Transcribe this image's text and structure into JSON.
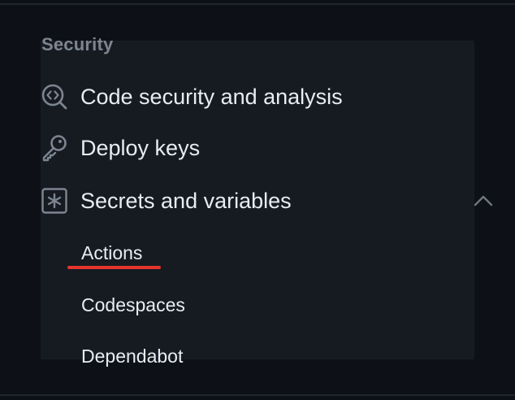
{
  "section": {
    "title": "Security"
  },
  "nav": {
    "items": [
      {
        "label": "Code security and analysis",
        "icon": "codescan-icon"
      },
      {
        "label": "Deploy keys",
        "icon": "key-icon"
      },
      {
        "label": "Secrets and variables",
        "icon": "key-asterisk-icon",
        "expanded": true
      }
    ],
    "subitems": [
      {
        "label": "Actions",
        "active": true
      },
      {
        "label": "Codespaces",
        "active": false
      },
      {
        "label": "Dependabot",
        "active": false
      }
    ]
  },
  "colors": {
    "background": "#0d1117",
    "panel": "#161b22",
    "text": "#e6edf3",
    "muted": "#7d8590",
    "active_indicator": "#e5342a"
  }
}
